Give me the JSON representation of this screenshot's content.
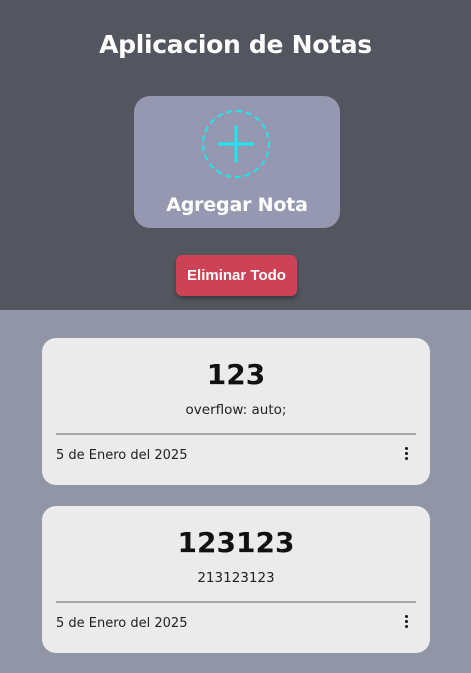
{
  "header": {
    "title": "Aplicacion de Notas",
    "add_note_label": "Agregar Nota",
    "add_icon": "plus-circle-icon",
    "delete_all_label": "Eliminar Todo"
  },
  "notes": [
    {
      "title": "123",
      "body": "overflow: auto;",
      "date": "5 de Enero del 2025",
      "menu_icon": "kebab-menu-icon"
    },
    {
      "title": "123123",
      "body": "213123123",
      "date": "5 de Enero del 2025",
      "menu_icon": "kebab-menu-icon"
    }
  ],
  "colors": {
    "header_bg": "#53565f",
    "page_bg": "#9295a5",
    "add_card_bg": "#9598b0",
    "accent_cyan": "#1ce6ef",
    "danger": "#cd4256",
    "note_bg": "#ebebeb"
  }
}
